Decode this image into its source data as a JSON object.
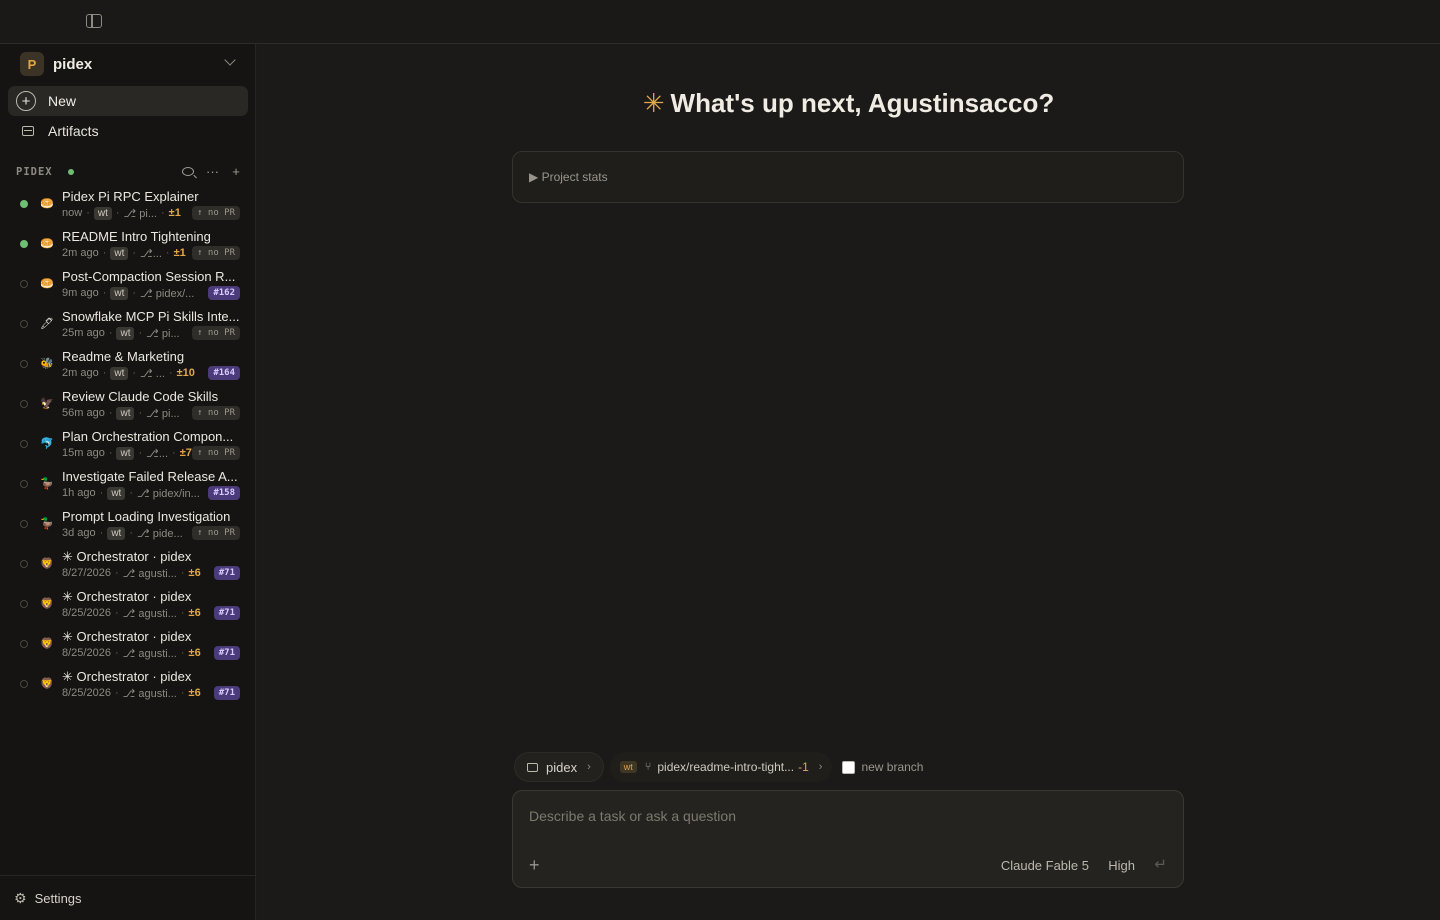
{
  "project": {
    "initial": "P",
    "name": "pidex"
  },
  "nav": {
    "new_label": "New",
    "artifacts_label": "Artifacts"
  },
  "section": {
    "title": "PIDEX"
  },
  "threads": [
    {
      "title": "Pidex Pi RPC Explainer",
      "time": "now",
      "wt": "wt",
      "branch": "⎇ pi...",
      "diff": "±1",
      "pr": "↑ no PR",
      "pr_kind": "nopr",
      "active": true,
      "emoji": "🥯"
    },
    {
      "title": "README Intro Tightening",
      "time": "2m ago",
      "wt": "wt",
      "branch": "⎇...",
      "diff": "±1",
      "pr": "↑ no PR",
      "pr_kind": "nopr",
      "active": true,
      "emoji": "🥯"
    },
    {
      "title": "Post-Compaction Session R...",
      "time": "9m ago",
      "wt": "wt",
      "branch": "⎇ pidex/...",
      "diff": "",
      "pr": "#162",
      "pr_kind": "num",
      "active": false,
      "emoji": "🥯"
    },
    {
      "title": "Snowflake MCP Pi Skills Inte...",
      "time": "25m ago",
      "wt": "wt",
      "branch": "⎇ pi...",
      "diff": "",
      "pr": "↑ no PR",
      "pr_kind": "nopr",
      "active": false,
      "emoji": "🖊"
    },
    {
      "title": "Readme & Marketing",
      "time": "2m ago",
      "wt": "wt",
      "branch": "⎇ ...",
      "diff": "±10",
      "pr": "#164",
      "pr_kind": "num",
      "active": false,
      "emoji": "🐝"
    },
    {
      "title": "Review Claude Code Skills",
      "time": "56m ago",
      "wt": "wt",
      "branch": "⎇ pi...",
      "diff": "",
      "pr": "↑ no PR",
      "pr_kind": "nopr",
      "active": false,
      "emoji": "🦅"
    },
    {
      "title": "Plan Orchestration Compon...",
      "time": "15m ago",
      "wt": "wt",
      "branch": "⎇...",
      "diff": "±7",
      "pr": "↑ no PR",
      "pr_kind": "nopr",
      "active": false,
      "emoji": "🐬"
    },
    {
      "title": "Investigate Failed Release A...",
      "time": "1h ago",
      "wt": "wt",
      "branch": "⎇ pidex/in...",
      "diff": "",
      "pr": "#158",
      "pr_kind": "num",
      "active": false,
      "emoji": "🦆"
    },
    {
      "title": "Prompt Loading Investigation",
      "time": "3d ago",
      "wt": "wt",
      "branch": "⎇ pide...",
      "diff": "",
      "pr": "↑ no PR",
      "pr_kind": "nopr",
      "active": false,
      "emoji": "🦆"
    },
    {
      "title": "✳ Orchestrator · pidex",
      "time": "8/27/2026",
      "wt": "",
      "branch": "⎇ agusti...",
      "diff": "±6",
      "pr": "#71",
      "pr_kind": "num",
      "active": false,
      "emoji": "🦁"
    },
    {
      "title": "✳ Orchestrator · pidex",
      "time": "8/25/2026",
      "wt": "",
      "branch": "⎇ agusti...",
      "diff": "±6",
      "pr": "#71",
      "pr_kind": "num",
      "active": false,
      "emoji": "🦁"
    },
    {
      "title": "✳ Orchestrator · pidex",
      "time": "8/25/2026",
      "wt": "",
      "branch": "⎇ agusti...",
      "diff": "±6",
      "pr": "#71",
      "pr_kind": "num",
      "active": false,
      "emoji": "🦁"
    },
    {
      "title": "✳ Orchestrator · pidex",
      "time": "8/25/2026",
      "wt": "",
      "branch": "⎇ agusti...",
      "diff": "±6",
      "pr": "#71",
      "pr_kind": "num",
      "active": false,
      "emoji": "🦁"
    }
  ],
  "settings_label": "Settings",
  "main": {
    "greeting_icon": "✳",
    "greeting": "What's up next, Agustinsacco?",
    "stats_label": "▶ Project stats"
  },
  "context": {
    "folder": "pidex",
    "wt": "wt",
    "branch": "pidex/readme-intro-tight...",
    "branch_diff": "-1",
    "new_branch_label": "new branch"
  },
  "composer": {
    "placeholder": "Describe a task or ask a question",
    "model": "Claude Fable 5",
    "effort": "High"
  },
  "colors": {
    "accent": "#e3a74a",
    "online": "#6fbf73",
    "pr_badge": "#4b3b7a"
  }
}
